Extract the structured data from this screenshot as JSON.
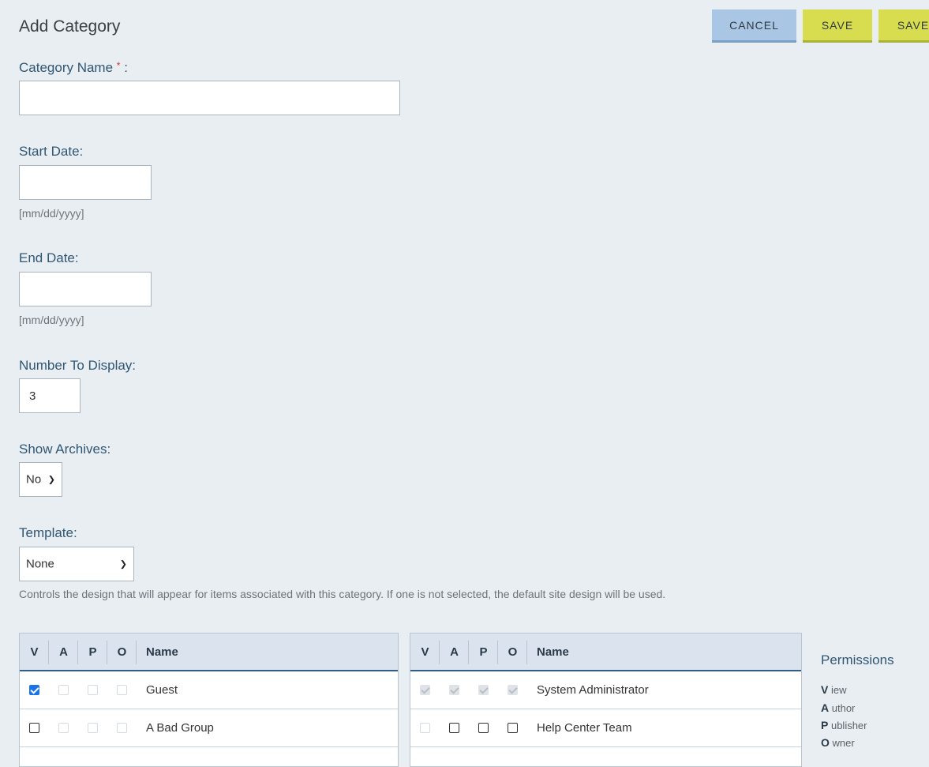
{
  "header": {
    "title": "Add Category",
    "cancel_label": "CANCEL",
    "save_label": "SAVE",
    "save2_label": "SAVE"
  },
  "form": {
    "category_name": {
      "label": "Category Name",
      "required_mark": "*",
      "suffix": " :",
      "value": ""
    },
    "start_date": {
      "label": "Start Date:",
      "value": "",
      "hint": "[mm/dd/yyyy]"
    },
    "end_date": {
      "label": "End Date:",
      "value": "",
      "hint": "[mm/dd/yyyy]"
    },
    "number_to_display": {
      "label": "Number To Display:",
      "value": "3"
    },
    "show_archives": {
      "label": "Show Archives:",
      "selected": "No"
    },
    "template": {
      "label": "Template:",
      "selected": "None",
      "description": "Controls the design that will appear for items associated with this category. If one is not selected, the default site design will be used."
    }
  },
  "tables": {
    "headers": [
      "V",
      "A",
      "P",
      "O",
      "Name"
    ],
    "left": {
      "rows": [
        {
          "name": "Guest",
          "v": "checked",
          "a": "disabled",
          "p": "disabled",
          "o": "disabled"
        },
        {
          "name": "A Bad Group",
          "v": "unchecked",
          "a": "disabled",
          "p": "disabled",
          "o": "disabled"
        }
      ]
    },
    "right": {
      "rows": [
        {
          "name": "System Administrator",
          "v": "checked-disabled",
          "a": "checked-disabled",
          "p": "checked-disabled",
          "o": "checked-disabled"
        },
        {
          "name": "Help Center Team",
          "v": "disabled",
          "a": "unchecked",
          "p": "unchecked",
          "o": "unchecked"
        }
      ]
    }
  },
  "permissions": {
    "title": "Permissions",
    "items": [
      {
        "letter": "V",
        "rest": "iew"
      },
      {
        "letter": "A",
        "rest": "uthor"
      },
      {
        "letter": "P",
        "rest": "ublisher"
      },
      {
        "letter": "O",
        "rest": "wner"
      }
    ]
  }
}
